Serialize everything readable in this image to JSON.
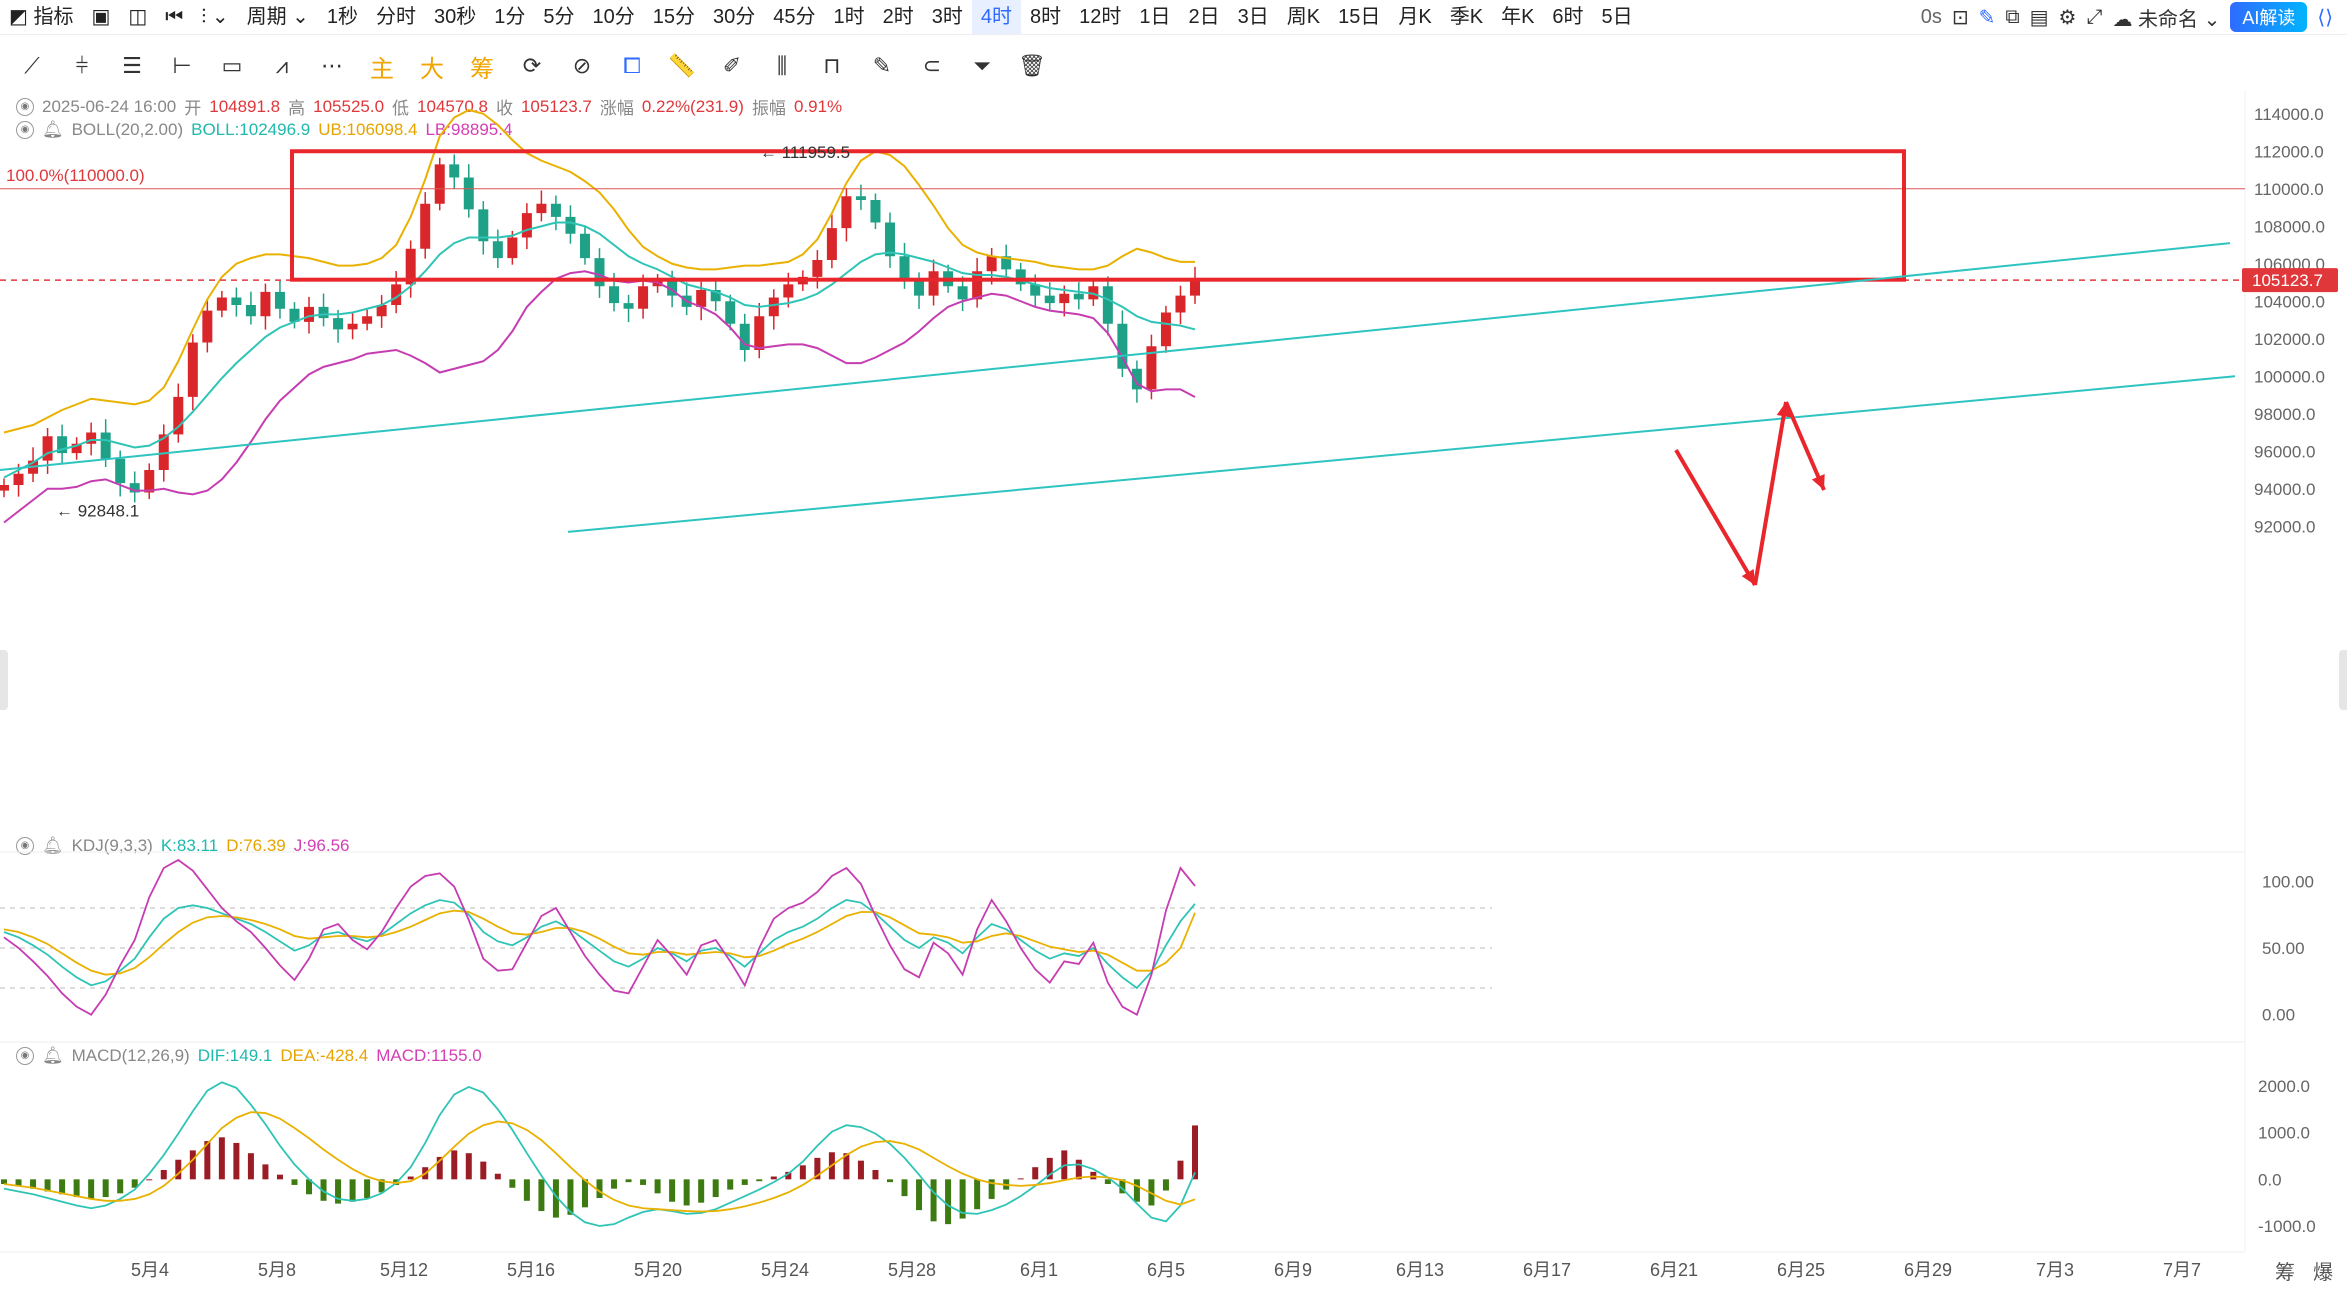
{
  "topbar": {
    "indicators_label": "指标",
    "period_label": "周期",
    "periods": [
      "1秒",
      "分时",
      "30秒",
      "1分",
      "5分",
      "10分",
      "15分",
      "30分",
      "45分",
      "1时",
      "2时",
      "3时",
      "4时",
      "8时",
      "12时",
      "1日",
      "2日",
      "3日",
      "周K",
      "15日",
      "月K",
      "季K",
      "年K",
      "6时",
      "5日"
    ],
    "active_period": "4时",
    "timer": "0s",
    "layout_name": "未命名",
    "ai_button": "AI解读"
  },
  "toolbar": {
    "main_tag": "主",
    "big_tag": "大",
    "chip_tag": "筹"
  },
  "ohlc": {
    "date": "2025-06-24 16:00",
    "open_label": "开",
    "open": "104891.8",
    "high_label": "高",
    "high": "105525.0",
    "low_label": "低",
    "low": "104570.8",
    "close_label": "收",
    "close": "105123.7",
    "change_label": "涨幅",
    "change": "0.22%(231.9)",
    "amplitude_label": "振幅",
    "amplitude": "0.91%"
  },
  "boll": {
    "name": "BOLL(20,2.00)",
    "mid": "BOLL:102496.9",
    "ub": "UB:106098.4",
    "lb": "LB:98895.4"
  },
  "kdj": {
    "name": "KDJ(9,3,3)",
    "k": "K:83.11",
    "d": "D:76.39",
    "j": "J:96.56"
  },
  "macd": {
    "name": "MACD(12,26,9)",
    "dif": "DIF:149.1",
    "dea": "DEA:-428.4",
    "macd": "MACD:1155.0"
  },
  "annotations": {
    "fib_label": "100.0%(110000.0)",
    "high_marker": "111959.5",
    "low_marker": "92848.1",
    "current_price": "105123.7"
  },
  "corner_labels": [
    "筹",
    "爆"
  ],
  "colors": {
    "up": "#d8262b",
    "down": "#1fa187",
    "boll_mid": "#2ec4b6",
    "boll_ub": "#e9b100",
    "boll_lb": "#c63cb1",
    "rectangle": "#e8262b",
    "trendline": "#2ec4c0",
    "macd_pos": "#9b1c24",
    "macd_neg": "#3d7a12",
    "accent": "#2f6bff"
  },
  "chart_data": [
    {
      "type": "candlestick",
      "title": "",
      "ylim": [
        91000,
        115000
      ],
      "yticks": [
        "114000.0",
        "112000.0",
        "110000.0",
        "108000.0",
        "106000.0",
        "104000.0",
        "102000.0",
        "100000.0",
        "98000.0",
        "96000.0",
        "94000.0",
        "92000.0"
      ],
      "xticks": [
        "5月4",
        "5月8",
        "5月12",
        "5月16",
        "5月20",
        "5月24",
        "5月28",
        "6月1",
        "6月5",
        "6月9",
        "6月13",
        "6月17",
        "6月21",
        "6月25",
        "6月29",
        "7月3",
        "7月7"
      ],
      "close_series": [
        94200,
        94800,
        95500,
        96800,
        95900,
        96400,
        97000,
        95600,
        94300,
        93800,
        95000,
        96900,
        98900,
        101800,
        103500,
        104200,
        103800,
        103200,
        104500,
        103600,
        102900,
        103700,
        103100,
        102500,
        102800,
        103200,
        103800,
        104900,
        106800,
        109200,
        111300,
        110600,
        108900,
        107200,
        106300,
        107400,
        108700,
        109200,
        108500,
        107600,
        106300,
        104800,
        103900,
        103600,
        104800,
        105100,
        104300,
        103700,
        104600,
        104000,
        102800,
        101400,
        103200,
        104200,
        104900,
        105300,
        106200,
        107900,
        109600,
        109400,
        108200,
        106400,
        105100,
        104300,
        105600,
        104800,
        104100,
        105600,
        106400,
        105700,
        104900,
        104300,
        103900,
        104400,
        104100,
        104800,
        102800,
        100400,
        99300,
        101600,
        103400,
        104300,
        105123.7
      ],
      "bb_mid_series": [
        94600,
        95000,
        95400,
        95900,
        96100,
        96300,
        96600,
        96600,
        96400,
        96200,
        96300,
        96700,
        97300,
        98100,
        99000,
        99900,
        100700,
        101400,
        102100,
        102600,
        102900,
        103200,
        103300,
        103300,
        103400,
        103600,
        103800,
        104200,
        104800,
        105600,
        106500,
        107100,
        107400,
        107400,
        107400,
        107500,
        107800,
        108000,
        108200,
        108200,
        108000,
        107600,
        107000,
        106400,
        106000,
        105700,
        105300,
        104900,
        104700,
        104500,
        104200,
        103800,
        103700,
        103800,
        103900,
        104100,
        104400,
        104900,
        105500,
        106100,
        106500,
        106600,
        106500,
        106300,
        106100,
        105800,
        105500,
        105400,
        105400,
        105300,
        105100,
        104900,
        104700,
        104600,
        104500,
        104400,
        104100,
        103700,
        103200,
        102900,
        102800,
        102700,
        102496.9
      ],
      "bb_upper_series": [
        97000,
        97200,
        97400,
        97800,
        98200,
        98500,
        98800,
        98700,
        98600,
        98500,
        98700,
        99400,
        100800,
        102500,
        104100,
        105300,
        106000,
        106300,
        106500,
        106500,
        106400,
        106300,
        106100,
        105900,
        105900,
        106000,
        106300,
        107000,
        108500,
        110500,
        112800,
        113800,
        114200,
        114000,
        113400,
        112600,
        111900,
        111500,
        111200,
        110900,
        110400,
        109800,
        108900,
        107800,
        106900,
        106400,
        106000,
        105800,
        105700,
        105700,
        105800,
        105900,
        105900,
        106000,
        106100,
        106500,
        107300,
        108700,
        110300,
        111500,
        112000,
        111800,
        111200,
        110200,
        109100,
        107900,
        107000,
        106600,
        106400,
        106300,
        106200,
        106100,
        105900,
        105800,
        105700,
        105700,
        105900,
        106400,
        106800,
        106600,
        106300,
        106100,
        106098.4
      ],
      "bb_lower_series": [
        92200,
        92800,
        93400,
        94000,
        94000,
        94100,
        94400,
        94500,
        94200,
        93900,
        93900,
        94000,
        93800,
        93700,
        93900,
        94500,
        95400,
        96500,
        97700,
        98700,
        99400,
        100100,
        100500,
        100700,
        100900,
        101200,
        101300,
        101400,
        101100,
        100700,
        100200,
        100400,
        100600,
        100800,
        101400,
        102400,
        103700,
        104500,
        105200,
        105500,
        105600,
        105400,
        105100,
        105000,
        105100,
        105000,
        104600,
        104000,
        103700,
        103300,
        102600,
        101700,
        101500,
        101600,
        101700,
        101700,
        101500,
        101100,
        100700,
        100700,
        101000,
        101400,
        101800,
        102400,
        103100,
        103700,
        104000,
        104200,
        104400,
        104300,
        104000,
        103700,
        103500,
        103400,
        103300,
        103100,
        102300,
        101000,
        99600,
        99200,
        99300,
        99300,
        98895.4
      ]
    },
    {
      "type": "line",
      "title": "KDJ(9,3,3)",
      "ylim": [
        -10,
        110
      ],
      "yticks": [
        "100.00",
        "50.00",
        "0.00"
      ],
      "series": [
        {
          "name": "K",
          "values": [
            62,
            58,
            52,
            45,
            36,
            28,
            22,
            25,
            33,
            42,
            58,
            72,
            80,
            82,
            80,
            76,
            72,
            68,
            62,
            55,
            48,
            52,
            60,
            62,
            58,
            55,
            60,
            68,
            76,
            82,
            86,
            84,
            75,
            62,
            55,
            52,
            58,
            66,
            70,
            64,
            56,
            48,
            40,
            36,
            42,
            50,
            46,
            40,
            48,
            50,
            44,
            36,
            46,
            56,
            62,
            66,
            72,
            80,
            86,
            84,
            76,
            66,
            56,
            50,
            58,
            54,
            46,
            58,
            68,
            64,
            56,
            48,
            42,
            46,
            44,
            50,
            38,
            28,
            20,
            32,
            52,
            70,
            83.11
          ]
        },
        {
          "name": "D",
          "values": [
            64,
            62,
            58,
            53,
            46,
            39,
            33,
            30,
            31,
            35,
            43,
            53,
            62,
            69,
            73,
            74,
            73,
            71,
            68,
            64,
            59,
            57,
            58,
            59,
            59,
            58,
            59,
            62,
            66,
            71,
            76,
            78,
            77,
            72,
            66,
            61,
            60,
            62,
            65,
            65,
            62,
            57,
            51,
            46,
            45,
            47,
            47,
            45,
            46,
            47,
            46,
            43,
            44,
            48,
            53,
            57,
            62,
            68,
            74,
            77,
            77,
            73,
            67,
            61,
            60,
            58,
            54,
            55,
            59,
            61,
            59,
            55,
            51,
            49,
            47,
            48,
            45,
            39,
            33,
            33,
            39,
            50,
            76.39
          ]
        },
        {
          "name": "J",
          "values": [
            58,
            50,
            40,
            29,
            16,
            6,
            0,
            15,
            37,
            56,
            88,
            110,
            116,
            108,
            94,
            80,
            70,
            62,
            50,
            37,
            26,
            42,
            64,
            68,
            56,
            49,
            62,
            80,
            96,
            104,
            106,
            96,
            71,
            42,
            33,
            34,
            54,
            74,
            80,
            62,
            44,
            30,
            18,
            16,
            36,
            56,
            44,
            30,
            52,
            56,
            40,
            22,
            50,
            72,
            80,
            84,
            92,
            104,
            110,
            98,
            74,
            52,
            34,
            28,
            54,
            46,
            30,
            64,
            86,
            70,
            50,
            34,
            24,
            40,
            38,
            54,
            24,
            6,
            0,
            30,
            78,
            110,
            96.56
          ]
        }
      ]
    },
    {
      "type": "bar",
      "title": "MACD(12,26,9)",
      "ylim": [
        -1300,
        2300
      ],
      "yticks": [
        "2000.0",
        "1000.0",
        "0.0",
        "-1000.0"
      ],
      "series": [
        {
          "name": "MACD",
          "values": [
            -100,
            -150,
            -200,
            -260,
            -320,
            -380,
            -420,
            -380,
            -300,
            -180,
            0,
            200,
            420,
            620,
            820,
            900,
            780,
            560,
            320,
            100,
            -120,
            -320,
            -460,
            -520,
            -480,
            -400,
            -280,
            -120,
            60,
            260,
            480,
            620,
            560,
            380,
            120,
            -180,
            -460,
            -680,
            -820,
            -760,
            -600,
            -400,
            -200,
            -60,
            -120,
            -300,
            -480,
            -560,
            -500,
            -380,
            -220,
            -120,
            -40,
            60,
            160,
            300,
            460,
            580,
            560,
            400,
            200,
            -60,
            -360,
            -660,
            -900,
            -960,
            -840,
            -640,
            -420,
            -220,
            20,
            260,
            460,
            620,
            420,
            160,
            -100,
            -300,
            -480,
            -560,
            -240,
            400,
            1155
          ]
        },
        {
          "name": "DIF",
          "values": [
            -200,
            -260,
            -320,
            -400,
            -480,
            -560,
            -620,
            -560,
            -420,
            -220,
            120,
            520,
            980,
            1460,
            1900,
            2080,
            1960,
            1600,
            1180,
            720,
            320,
            0,
            -260,
            -420,
            -460,
            -420,
            -300,
            -80,
            260,
            780,
            1380,
            1820,
            1980,
            1860,
            1500,
            1060,
            560,
            80,
            -360,
            -700,
            -920,
            -1000,
            -960,
            -820,
            -700,
            -640,
            -680,
            -740,
            -720,
            -640,
            -500,
            -360,
            -220,
            -60,
            120,
            380,
            720,
            1020,
            1160,
            1120,
            980,
            760,
            460,
            100,
            -280,
            -560,
            -720,
            -740,
            -660,
            -540,
            -360,
            -140,
            100,
            300,
            320,
            220,
            40,
            -200,
            -520,
            -820,
            -900,
            -560,
            149.1
          ]
        },
        {
          "name": "DEA",
          "values": [
            -100,
            -140,
            -180,
            -240,
            -300,
            -360,
            -420,
            -460,
            -460,
            -420,
            -320,
            -140,
            120,
            420,
            760,
            1100,
            1320,
            1440,
            1420,
            1300,
            1100,
            880,
            640,
            420,
            220,
            60,
            -40,
            -80,
            -40,
            120,
            400,
            700,
            980,
            1160,
            1240,
            1200,
            1060,
            840,
            560,
            260,
            -20,
            -260,
            -440,
            -560,
            -620,
            -640,
            -660,
            -680,
            -690,
            -680,
            -640,
            -580,
            -500,
            -400,
            -280,
            -120,
            80,
            300,
            520,
            700,
            800,
            820,
            760,
            640,
            460,
            280,
            120,
            0,
            -80,
            -120,
            -140,
            -120,
            -80,
            -20,
            40,
            60,
            40,
            -20,
            -140,
            -300,
            -460,
            -540,
            -428.4
          ]
        }
      ]
    }
  ]
}
